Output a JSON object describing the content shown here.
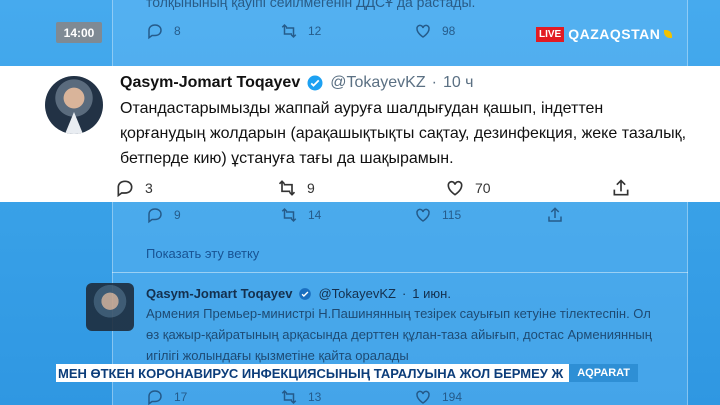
{
  "overlay": {
    "clock": "14:00",
    "live_badge": "LIVE",
    "channel_name": "QAZAQSTAN"
  },
  "top_tweet": {
    "text_fragment": "толқынының қауіпі сейілмегенін ДДСҰ да растады.",
    "replies": "8",
    "retweets": "12",
    "likes": "98"
  },
  "main_tweet": {
    "author_name": "Qasym-Jomart Toqayev",
    "handle": "@TokayevKZ",
    "time": "10 ч",
    "text": "Отандастарымызды жаппай ауруға шалдығудан қашып, індеттен қорғанудың жолдарын (арақашықтықты сақтау, дезинфекция, жеке тазалық, бетперде кию) ұстануға тағы да шақырамын.",
    "replies": "3",
    "retweets": "9",
    "likes": "70"
  },
  "second_actions": {
    "replies": "9",
    "retweets": "14",
    "likes": "115"
  },
  "show_thread_label": "Показать эту ветку",
  "quoted_tweet": {
    "author_name": "Qasym-Jomart Toqayev",
    "handle": "@TokayevKZ",
    "time": "1 июн.",
    "text": "Армения Премьер-министрі Н.Пашинянның тезірек сауығып кетуіне тілектеспін. Ол өз қажыр-қайратының арқасында дерттен құлан-таза айығып, достас Армениянның игілігі жолындағы қызметіне қайта оралады",
    "replies": "17",
    "retweets": "13",
    "likes": "194"
  },
  "ticker": {
    "text": "МЕН ӨТКЕН КОРОНАВИРУС ИНФЕКЦИЯСЫНЫҢ ТАРАЛУЫНА ЖОЛ БЕРМЕУ Ж",
    "tag": "AQPARAT"
  },
  "colors": {
    "background_blue": "#3fa6ea",
    "live_red": "#e21b23",
    "verified_blue": "#1da1f2",
    "ticker_blue": "#0c3d7a"
  }
}
